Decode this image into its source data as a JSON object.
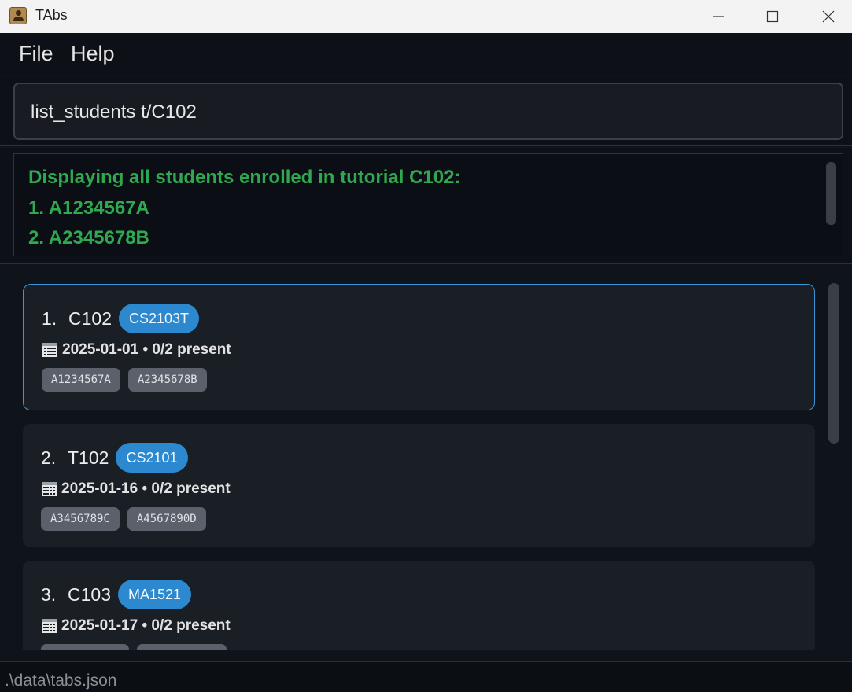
{
  "window": {
    "title": "TAbs"
  },
  "menu": {
    "file": "File",
    "help": "Help"
  },
  "command": {
    "value": "list_students t/C102"
  },
  "result": {
    "lines": [
      "Displaying all students enrolled in tutorial C102:",
      "1. A1234567A",
      "2. A2345678B"
    ],
    "color": "#2fa84f"
  },
  "tutorials": [
    {
      "index": "1.",
      "name": "C102",
      "module": "CS2103T",
      "date": "2025-01-01",
      "attendance": "• 0/2 present",
      "students": [
        "A1234567A",
        "A2345678B"
      ],
      "selected": true
    },
    {
      "index": "2.",
      "name": "T102",
      "module": "CS2101",
      "date": "2025-01-16",
      "attendance": "• 0/2 present",
      "students": [
        "A3456789C",
        "A4567890D"
      ],
      "selected": false
    },
    {
      "index": "3.",
      "name": "C103",
      "module": "MA1521",
      "date": "2025-01-17",
      "attendance": "• 0/2 present",
      "students": [
        "",
        ""
      ],
      "selected": false
    }
  ],
  "status": {
    "path": ".\\data\\tabs.json"
  },
  "colors": {
    "accent": "#2c89d0",
    "selected_border": "#3b95d9",
    "background": "#0f131a"
  },
  "icons": {
    "calendar": "calendar-icon",
    "app": "address-book-icon"
  }
}
